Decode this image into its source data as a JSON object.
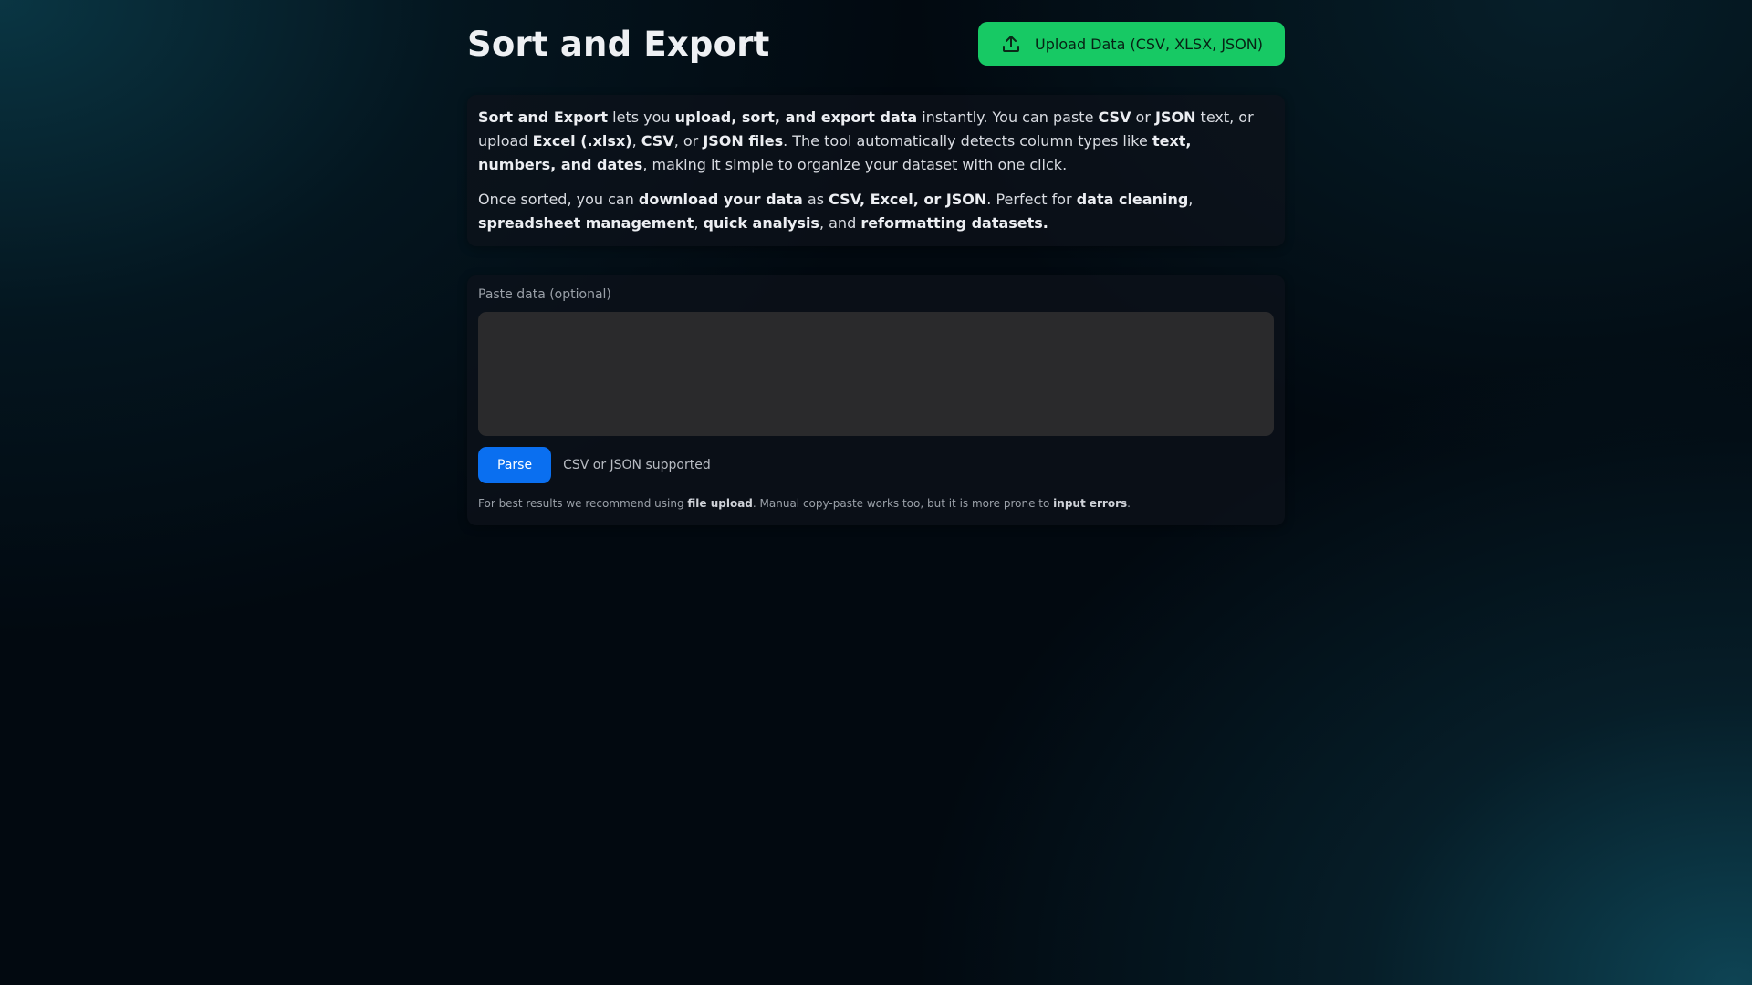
{
  "header": {
    "title": "Sort and Export",
    "upload_button_label": "Upload Data (CSV, XLSX, JSON)",
    "upload_icon": "upload-icon",
    "accent_color": "#17c964"
  },
  "intro": {
    "p1": {
      "s1": "Sort and Export",
      "s2": " lets you ",
      "s3": "upload, sort, and export data",
      "s4": " instantly. You can paste ",
      "s5": "CSV",
      "s6": " or ",
      "s7": "JSON",
      "s8": " text, or upload ",
      "s9": "Excel (.xlsx)",
      "s10": ", ",
      "s11": "CSV",
      "s12": ", or ",
      "s13": "JSON files",
      "s14": ". The tool automatically detects column types like ",
      "s15": "text, numbers, and dates",
      "s16": ", making it simple to organize your dataset with one click."
    },
    "p2": {
      "s1": "Once sorted, you can ",
      "s2": "download your data",
      "s3": " as ",
      "s4": "CSV, Excel, or JSON",
      "s5": ". Perfect for ",
      "s6": "data cleaning",
      "s7": ", ",
      "s8": "spreadsheet management",
      "s9": ", ",
      "s10": "quick analysis",
      "s11": ", and ",
      "s12": "reformatting datasets."
    }
  },
  "paste": {
    "label": "Paste data (optional)",
    "value": "",
    "parse_button_label": "Parse",
    "hint": "CSV or JSON supported",
    "parse_color": "#0a6ff0",
    "footnote": {
      "s1": "For best results we recommend using ",
      "s2": "file upload",
      "s3": ". Manual copy-paste works too, but it is more prone to ",
      "s4": "input errors",
      "s5": "."
    }
  }
}
